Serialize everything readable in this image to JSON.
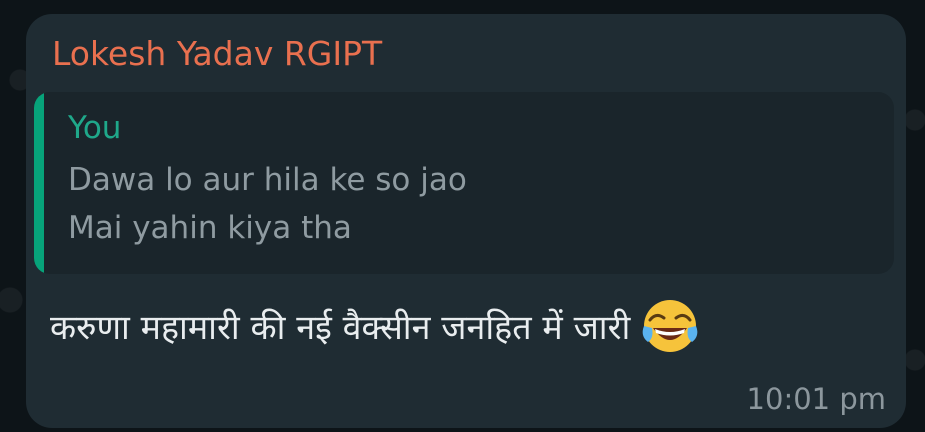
{
  "message": {
    "sender": "Lokesh Yadav RGIPT",
    "reply": {
      "author": "You",
      "lines": [
        "Dawa lo aur hila ke so jao",
        "Mai yahin kiya tha"
      ]
    },
    "text": "करुणा महामारी की नई वैक्सीन जनहित में जारी",
    "emoji_icon": "face-with-tears-of-joy-icon",
    "time": "10:01 pm"
  },
  "colors": {
    "bubble": "#1f2c33",
    "sender": "#e9704f",
    "reply_author": "#1fa88a",
    "reply_bar": "#07a37a",
    "reply_text": "#8f9ba1",
    "message_text": "#e9edef",
    "time": "#8c979d"
  }
}
